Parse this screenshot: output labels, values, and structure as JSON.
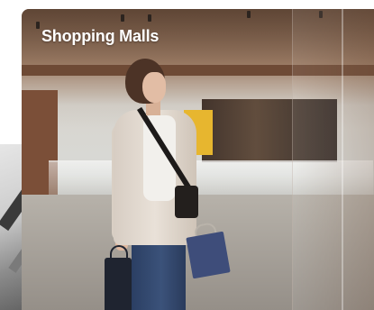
{
  "cards": {
    "main": {
      "title": "Shopping Malls"
    }
  }
}
